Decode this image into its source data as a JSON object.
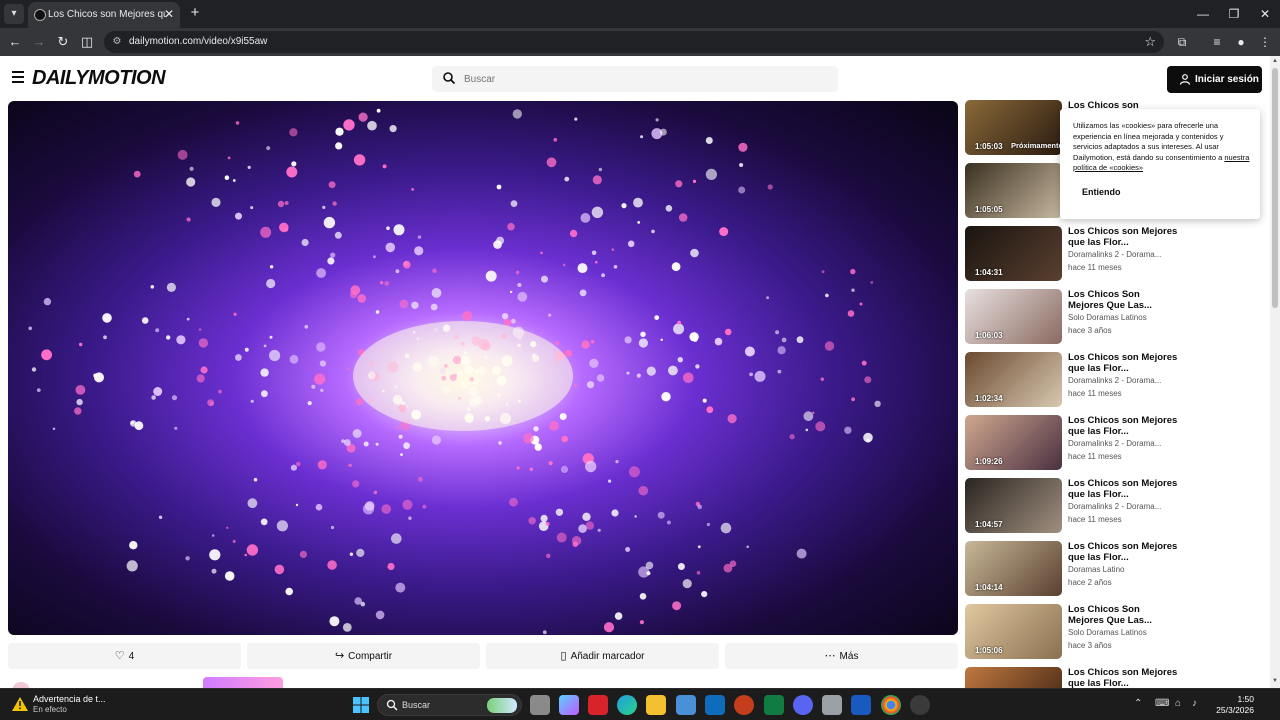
{
  "browser": {
    "tab_title": "Los Chicos son Mejores que las Flores",
    "url": "dailymotion.com/video/x9i55aw"
  },
  "site": {
    "logo": "DAILYMOTION",
    "search_placeholder": "Buscar",
    "signin_label": "Iniciar sesión"
  },
  "actions": {
    "likes": "4",
    "share": "Compartir",
    "bookmark": "Añadir marcador",
    "more": "Más"
  },
  "cookie": {
    "text": "Utilizamos las «cookies» para ofrecerle una experiencia en línea mejorada y contenidos y servicios adaptados a sus intereses. Al usar Dailymotion, está dando su consentimiento a",
    "link": "nuestra política de «cookies»",
    "accept": "Entiendo"
  },
  "sidebar": {
    "items": [
      {
        "title": "Los Chicos son",
        "channel": "",
        "age": "",
        "duration": "1:05:03",
        "badge": "Próximamente",
        "colors": [
          "#8a6a3a",
          "#2a1a10"
        ]
      },
      {
        "title": "",
        "channel": "",
        "age": "",
        "duration": "1:05:05",
        "badge": "",
        "colors": [
          "#3a3020",
          "#c8b8a0"
        ]
      },
      {
        "title": "Los Chicos son Mejores que las Flor...",
        "channel": "Doramalinks 2 - Dorama...",
        "age": "hace 11 meses",
        "duration": "1:04:31",
        "badge": "",
        "colors": [
          "#1a1410",
          "#5a4030"
        ]
      },
      {
        "title": "Los Chicos Son Mejores Que Las...",
        "channel": "Solo Doramas Latinos",
        "age": "hace 3 años",
        "duration": "1:06:03",
        "badge": "",
        "colors": [
          "#e8e0e0",
          "#8a6a60"
        ]
      },
      {
        "title": "Los Chicos son Mejores que las Flor...",
        "channel": "Doramalinks 2 - Dorama...",
        "age": "hace 11 meses",
        "duration": "1:02:34",
        "badge": "",
        "colors": [
          "#6a4a30",
          "#d8c8b0"
        ]
      },
      {
        "title": "Los Chicos son Mejores que las Flor...",
        "channel": "Doramalinks 2 - Dorama...",
        "age": "hace 11 meses",
        "duration": "1:09:26",
        "badge": "",
        "colors": [
          "#d0a890",
          "#4a3040"
        ]
      },
      {
        "title": "Los Chicos son Mejores que las Flor...",
        "channel": "Doramalinks 2 - Dorama...",
        "age": "hace 11 meses",
        "duration": "1:04:57",
        "badge": "",
        "colors": [
          "#2a2420",
          "#a09080"
        ]
      },
      {
        "title": "Los Chicos son Mejores que las Flor...",
        "channel": "Doramas Latino",
        "age": "hace 2 años",
        "duration": "1:04:14",
        "badge": "",
        "colors": [
          "#c8b898",
          "#5a4030"
        ]
      },
      {
        "title": "Los Chicos Son Mejores Que Las...",
        "channel": "Solo Doramas Latinos",
        "age": "hace 3 años",
        "duration": "1:05:06",
        "badge": "",
        "colors": [
          "#e0c8a0",
          "#8a7050"
        ]
      },
      {
        "title": "Los Chicos son Mejores que las Flor...",
        "channel": "",
        "age": "",
        "duration": "",
        "badge": "",
        "colors": [
          "#c07840",
          "#3a2010"
        ]
      }
    ]
  },
  "taskbar": {
    "warning_title": "Advertencia de t...",
    "warning_sub": "En efecto",
    "search_label": "Buscar",
    "time": "1:50",
    "date": "25/3/2026"
  }
}
